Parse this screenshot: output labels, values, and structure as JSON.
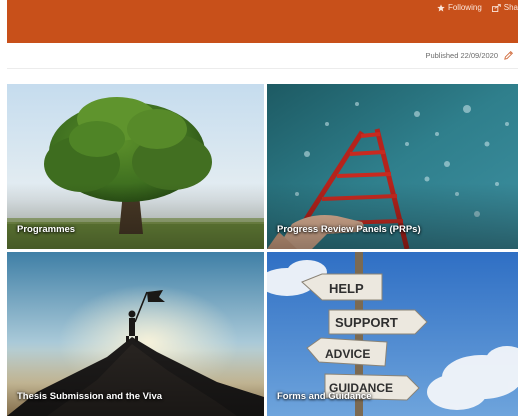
{
  "header": {
    "following_label": "Following",
    "share_label": "Sha"
  },
  "page": {
    "published": "Published 22/09/2020"
  },
  "tiles": [
    {
      "label": "Programmes"
    },
    {
      "label": "Progress Review Panels (PRPs)"
    },
    {
      "label": "Thesis Submission and the Viva"
    },
    {
      "label": "Forms and Guidance"
    }
  ],
  "signpost": {
    "signs": [
      "HELP",
      "SUPPORT",
      "ADVICE",
      "GUIDANCE"
    ]
  },
  "colors": {
    "brand": "#c8501a"
  },
  "icons": {
    "following": "star-icon",
    "share": "share-icon",
    "edit": "pencil-icon"
  }
}
